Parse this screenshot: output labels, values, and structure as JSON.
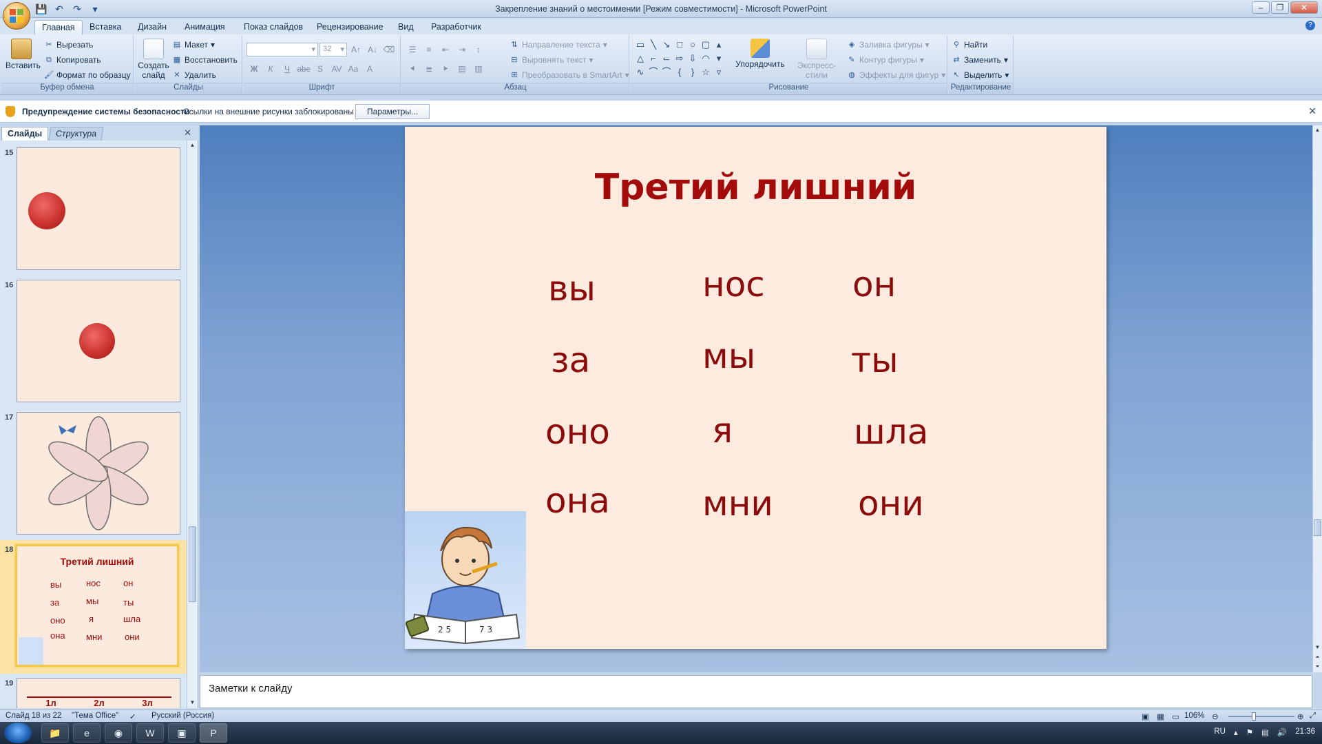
{
  "window": {
    "title": "Закрепление знаний о местоимении [Режим совместимости] - Microsoft PowerPoint"
  },
  "ribbon_tabs": [
    {
      "label": "Главная",
      "active": true
    },
    {
      "label": "Вставка"
    },
    {
      "label": "Дизайн"
    },
    {
      "label": "Анимация"
    },
    {
      "label": "Показ слайдов"
    },
    {
      "label": "Рецензирование"
    },
    {
      "label": "Вид"
    },
    {
      "label": "Разработчик"
    }
  ],
  "ribbon": {
    "clipboard": {
      "paste": "Вставить",
      "cut": "Вырезать",
      "copy": "Копировать",
      "format_painter": "Формат по образцу",
      "label": "Буфер обмена"
    },
    "slides": {
      "new_slide_line1": "Создать",
      "new_slide_line2": "слайд",
      "layout": "Макет",
      "reset": "Восстановить",
      "delete": "Удалить",
      "label": "Слайды"
    },
    "font": {
      "size": "32",
      "label": "Шрифт"
    },
    "paragraph": {
      "text_direction": "Направление текста",
      "align_text": "Выровнять текст",
      "convert_smartart": "Преобразовать в SmartArt",
      "label": "Абзац"
    },
    "drawing": {
      "arrange": "Упорядочить",
      "quick_styles": "Экспресс-стили",
      "shape_fill": "Заливка фигуры",
      "shape_outline": "Контур фигуры",
      "shape_effects": "Эффекты для фигур",
      "label": "Рисование"
    },
    "editing": {
      "find": "Найти",
      "replace": "Заменить",
      "select": "Выделить",
      "label": "Редактирование"
    }
  },
  "security_bar": {
    "title": "Предупреждение системы безопасности",
    "message": "Ссылки на внешние рисунки заблокированы",
    "options_button": "Параметры..."
  },
  "slide_panel": {
    "tabs": [
      "Слайды",
      "Структура"
    ],
    "thumbnails": [
      {
        "number": "15"
      },
      {
        "number": "16"
      },
      {
        "number": "17"
      },
      {
        "number": "18",
        "selected": true,
        "title": "Третий лишний"
      },
      {
        "number": "19",
        "headers": [
          "1л",
          "2л",
          "3л"
        ]
      }
    ]
  },
  "slide": {
    "title": "Третий лишний",
    "words": [
      [
        "вы",
        "нос",
        "он"
      ],
      [
        "за",
        "мы",
        "ты"
      ],
      [
        "оно",
        "я",
        "шла"
      ],
      [
        "она",
        "мни",
        "они"
      ]
    ]
  },
  "notes": {
    "placeholder": "Заметки к слайду"
  },
  "status": {
    "slide_counter": "Слайд 18 из 22",
    "theme": "\"Тема Office\"",
    "language": "Русский (Россия)",
    "zoom": "106%"
  },
  "taskbar": {
    "lang": "RU",
    "time": "21:36"
  },
  "colors": {
    "slide_bg": "#fdebdf",
    "title_red": "#a30a0a",
    "word_red": "#8b0b0b",
    "selection": "#f5c64a"
  }
}
